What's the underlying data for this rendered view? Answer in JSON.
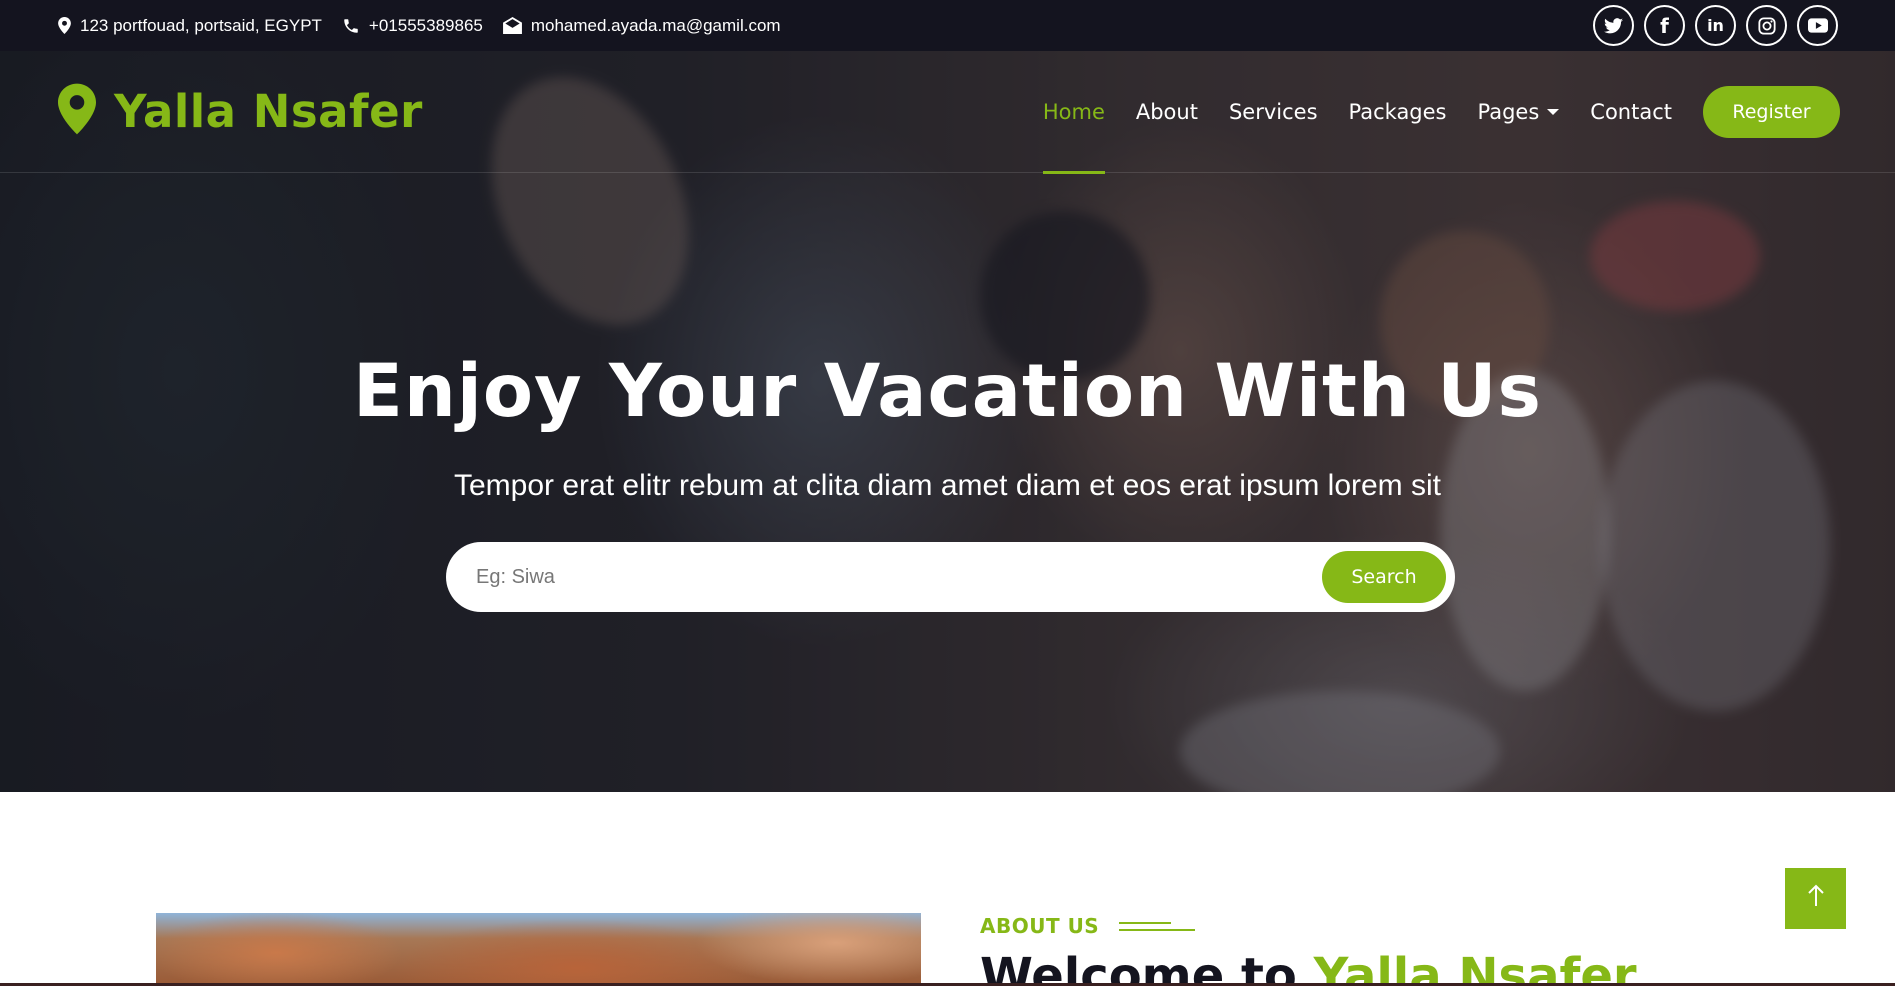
{
  "topbar": {
    "address": "123 portfouad, portsaid, EGYPT",
    "phone": "+01555389865",
    "email": "mohamed.ayada.ma@gamil.com",
    "socials": [
      {
        "name": "twitter-icon"
      },
      {
        "name": "facebook-icon",
        "glyph": "f"
      },
      {
        "name": "linkedin-icon",
        "glyph": "in"
      },
      {
        "name": "instagram-icon"
      },
      {
        "name": "youtube-icon"
      }
    ]
  },
  "brand": {
    "name": "Yalla Nsafer",
    "icon": "map-marker-icon"
  },
  "nav": {
    "home": "Home",
    "about": "About",
    "services": "Services",
    "packages": "Packages",
    "pages": "Pages",
    "contact": "Contact",
    "register": "Register"
  },
  "hero": {
    "title": "Enjoy Your Vacation With Us",
    "subtitle": "Tempor erat elitr rebum at clita diam amet diam et eos erat ipsum lorem sit",
    "search_placeholder": "Eg: Siwa",
    "search_button": "Search"
  },
  "about": {
    "label": "ABOUT US",
    "heading_prefix": "Welcome to",
    "heading_accent": "Yalla Nsafer"
  },
  "colors": {
    "accent": "#86b817",
    "dark": "#14141f",
    "white": "#ffffff"
  }
}
